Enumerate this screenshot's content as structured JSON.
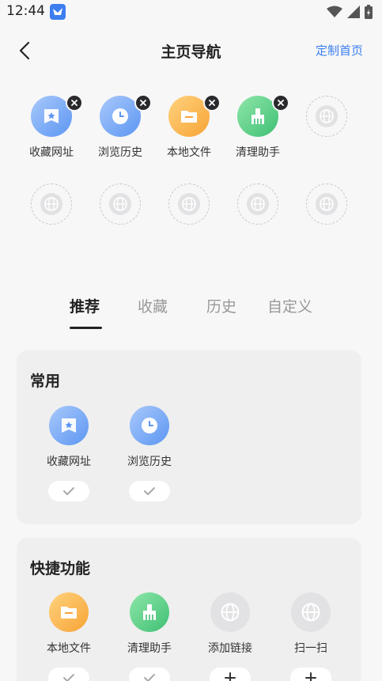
{
  "status": {
    "time": "12:44"
  },
  "header": {
    "title": "主页导航",
    "action": "定制首页"
  },
  "nav": {
    "items": [
      {
        "label": "收藏网址",
        "icon": "bookmark-icon"
      },
      {
        "label": "浏览历史",
        "icon": "clock-icon"
      },
      {
        "label": "本地文件",
        "icon": "folder-icon"
      },
      {
        "label": "清理助手",
        "icon": "broom-icon"
      }
    ]
  },
  "tabs": [
    {
      "label": "推荐",
      "active": true
    },
    {
      "label": "收藏",
      "active": false
    },
    {
      "label": "历史",
      "active": false
    },
    {
      "label": "自定义",
      "active": false
    }
  ],
  "sections": {
    "common": {
      "title": "常用",
      "items": [
        {
          "label": "收藏网址",
          "state": "added"
        },
        {
          "label": "浏览历史",
          "state": "added"
        }
      ]
    },
    "quick": {
      "title": "快捷功能",
      "items": [
        {
          "label": "本地文件",
          "state": "added"
        },
        {
          "label": "清理助手",
          "state": "added"
        },
        {
          "label": "添加链接",
          "state": "add"
        },
        {
          "label": "扫一扫",
          "state": "add"
        }
      ]
    }
  },
  "colors": {
    "accent": "#3b7ff0",
    "blue": "#5c96f2",
    "orange": "#f7a437",
    "green": "#3fc074"
  }
}
